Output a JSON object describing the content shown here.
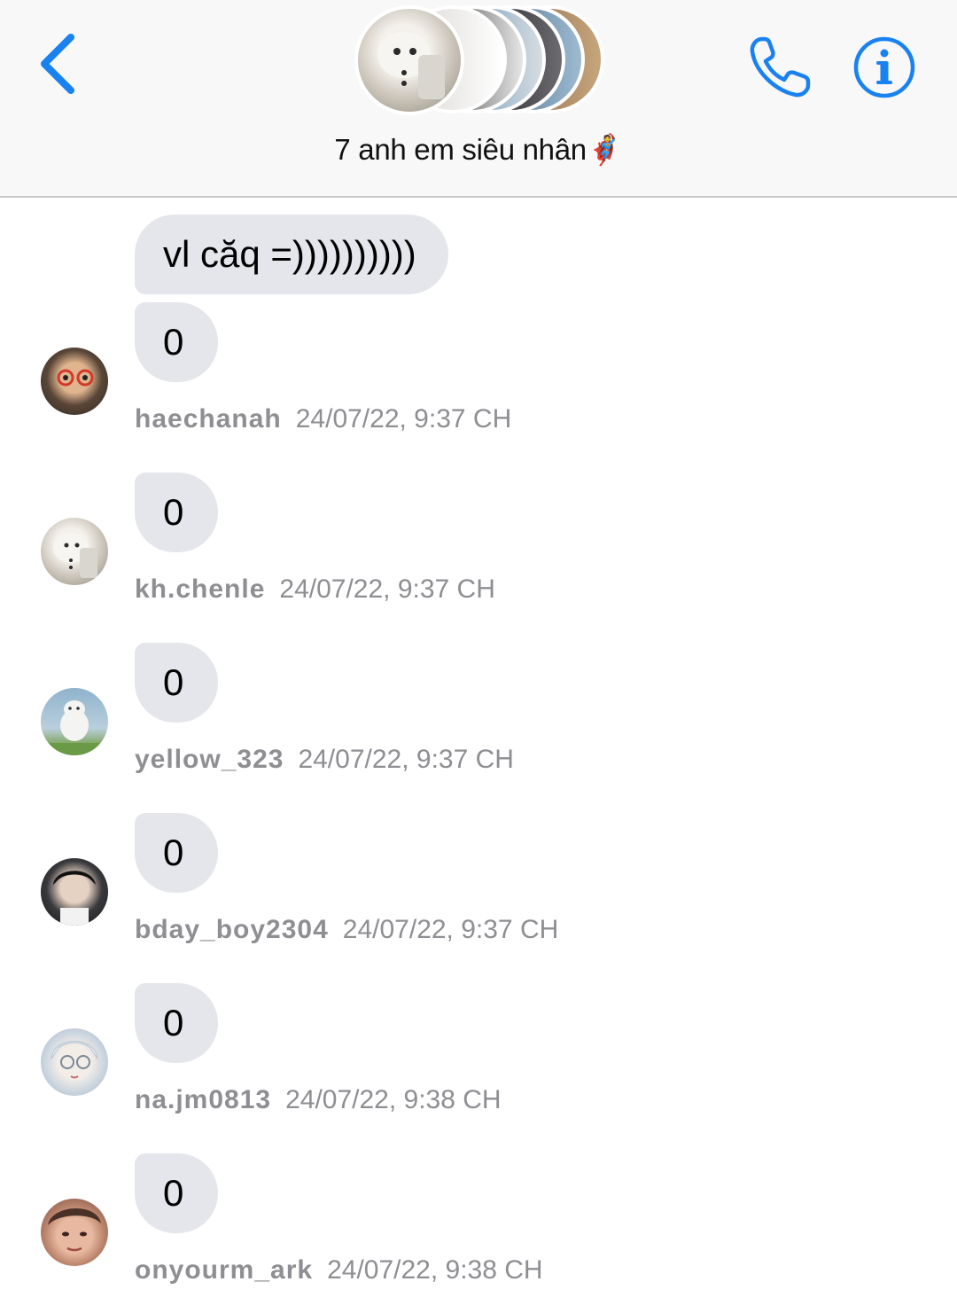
{
  "header": {
    "group_name": "7 anh em siêu nhân🦸",
    "back_icon": "chevron-left-icon",
    "call_icon": "phone-icon",
    "info_icon": "info-icon",
    "accent_color": "#1a82f0"
  },
  "first_message": {
    "text": "vl căq =))))))))))"
  },
  "messages": [
    {
      "text": "0",
      "sender": "haechanah",
      "time": "24/07/22, 9:37 CH"
    },
    {
      "text": "0",
      "sender": "kh.chenle",
      "time": "24/07/22, 9:37 CH"
    },
    {
      "text": "0",
      "sender": "yellow_323",
      "time": "24/07/22, 9:37 CH"
    },
    {
      "text": "0",
      "sender": "bday_boy2304",
      "time": "24/07/22, 9:37 CH"
    },
    {
      "text": "0",
      "sender": "na.jm0813",
      "time": "24/07/22, 9:38 CH"
    },
    {
      "text": "0",
      "sender": "onyourm_ark",
      "time": "24/07/22, 9:38 CH"
    }
  ]
}
